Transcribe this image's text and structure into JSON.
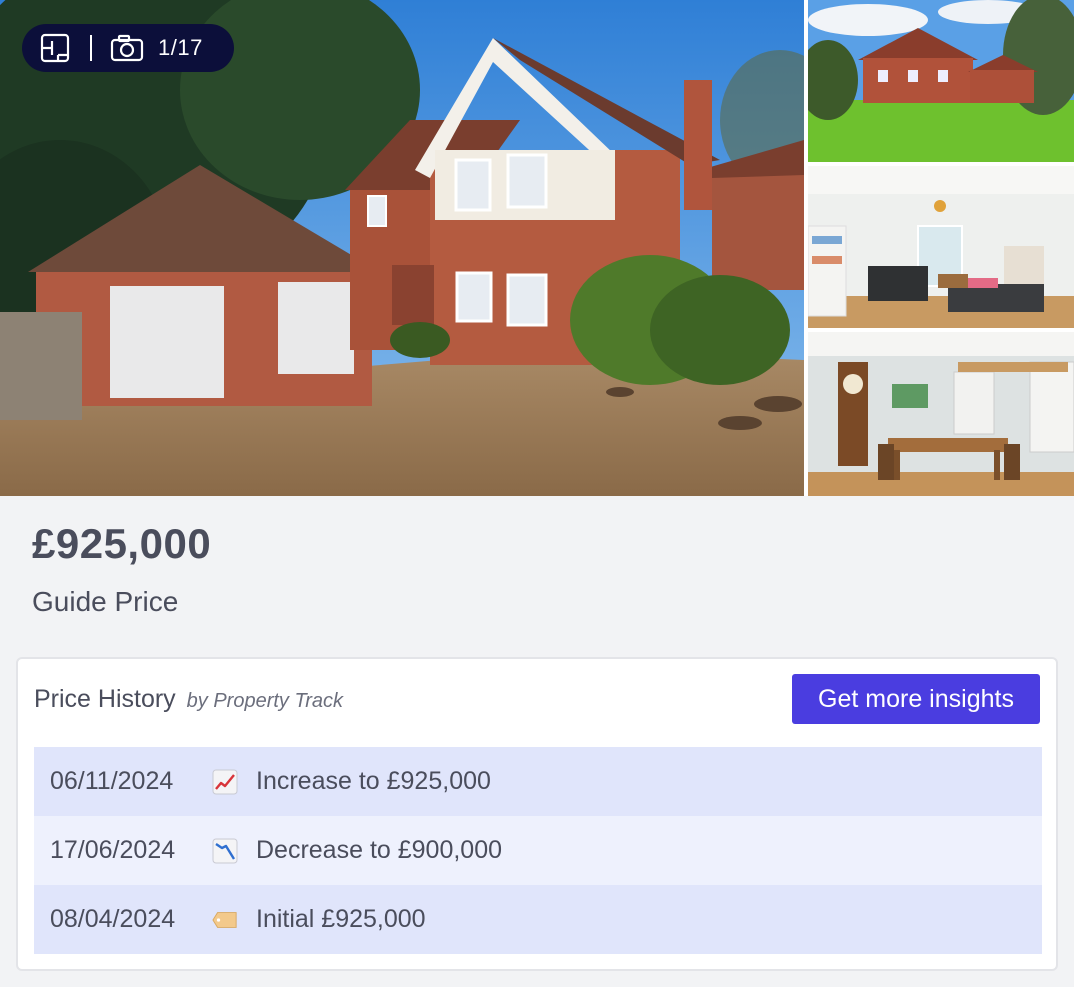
{
  "gallery": {
    "photo_counter": "1/17",
    "icons": {
      "floorplan": "floorplan-icon",
      "camera": "camera-icon"
    }
  },
  "listing": {
    "price": "£925,000",
    "price_qualifier": "Guide Price"
  },
  "price_history": {
    "title": "Price History",
    "provider": "by Property Track",
    "cta_label": "Get more insights",
    "entries": [
      {
        "date": "06/11/2024",
        "icon": "chart-increasing-icon",
        "text": "Increase to £925,000"
      },
      {
        "date": "17/06/2024",
        "icon": "chart-decreasing-icon",
        "text": "Decrease to £900,000"
      },
      {
        "date": "08/04/2024",
        "icon": "price-tag-icon",
        "text": "Initial £925,000"
      }
    ]
  },
  "colors": {
    "accent": "#4a3de0",
    "counter_bg": "#0c0f3a",
    "row_shade": "#e0e5fb",
    "row_light": "#eef1fd",
    "text": "#4a4d5c"
  }
}
